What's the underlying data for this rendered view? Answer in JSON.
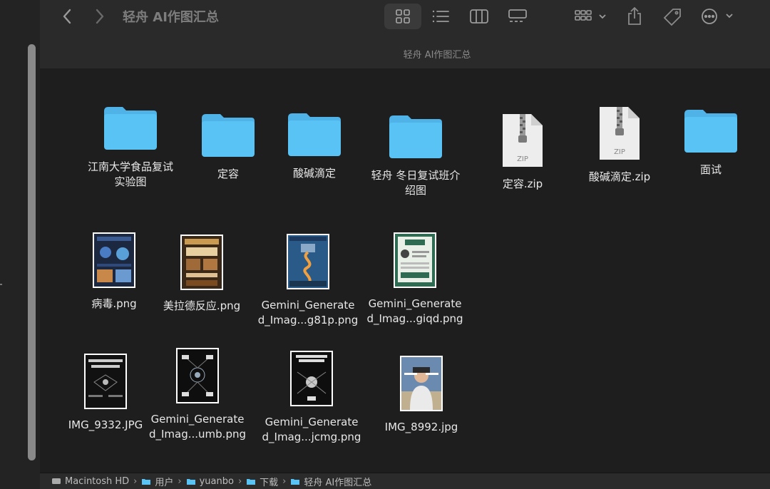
{
  "window": {
    "title": "轻舟 AI作图汇总",
    "subtitle": "轻舟 AI作图汇总"
  },
  "toolbar": {
    "back_icon": "chevron-left-icon",
    "forward_icon": "chevron-right-icon",
    "views": [
      "grid-view-icon",
      "list-view-icon",
      "column-view-icon",
      "gallery-view-icon"
    ],
    "group_icon": "group-by-icon",
    "share_icon": "share-icon",
    "tag_icon": "tag-icon",
    "more_icon": "ellipsis-icon"
  },
  "files": [
    {
      "name": "江南大学食品复试实验图",
      "line1": "江南大学食品复试",
      "line2": "实验图",
      "kind": "folder"
    },
    {
      "name": "定容",
      "line1": "定容",
      "line2": "",
      "kind": "folder"
    },
    {
      "name": "酸碱滴定",
      "line1": "酸碱滴定",
      "line2": "",
      "kind": "folder"
    },
    {
      "name": "轻舟 冬日复试班介绍图",
      "line1": "轻舟 冬日复试班介",
      "line2": "绍图",
      "kind": "folder"
    },
    {
      "name": "定容.zip",
      "line1": "定容.zip",
      "line2": "",
      "kind": "zip",
      "badge": "ZIP"
    },
    {
      "name": "酸碱滴定.zip",
      "line1": "酸碱滴定.zip",
      "line2": "",
      "kind": "zip",
      "badge": "ZIP"
    },
    {
      "name": "面试",
      "line1": "面试",
      "line2": "",
      "kind": "folder"
    },
    {
      "name": "病毒.png",
      "line1": "病毒.png",
      "line2": "",
      "kind": "image"
    },
    {
      "name": "美拉德反应.png",
      "line1": "美拉德反应.png",
      "line2": "",
      "kind": "image"
    },
    {
      "name": "Gemini_Generated_Imag...g81p.png",
      "line1": "Gemini_Generate",
      "line2": "d_Imag...g81p.png",
      "kind": "image"
    },
    {
      "name": "Gemini_Generated_Imag...giqd.png",
      "line1": "Gemini_Generate",
      "line2": "d_Imag...giqd.png",
      "kind": "image"
    },
    {
      "name": "IMG_9332.JPG",
      "line1": "IMG_9332.JPG",
      "line2": "",
      "kind": "image"
    },
    {
      "name": "Gemini_Generated_Imag...umb.png",
      "line1": "Gemini_Generate",
      "line2": "d_Imag...umb.png",
      "kind": "image"
    },
    {
      "name": "Gemini_Generated_Imag...jcmg.png",
      "line1": "Gemini_Generate",
      "line2": "d_Imag...jcmg.png",
      "kind": "image"
    },
    {
      "name": "IMG_8992.jpg",
      "line1": "IMG_8992.jpg",
      "line2": "",
      "kind": "image"
    }
  ],
  "pathbar": [
    "Macintosh HD",
    "用户",
    "yuanbo",
    "下载",
    "轻舟 AI作图汇总"
  ],
  "colors": {
    "folder": "#5ac3f5",
    "folder_tab": "#4fb3e8",
    "background": "#1e1e1e",
    "toolbar": "#2a2a2a"
  }
}
